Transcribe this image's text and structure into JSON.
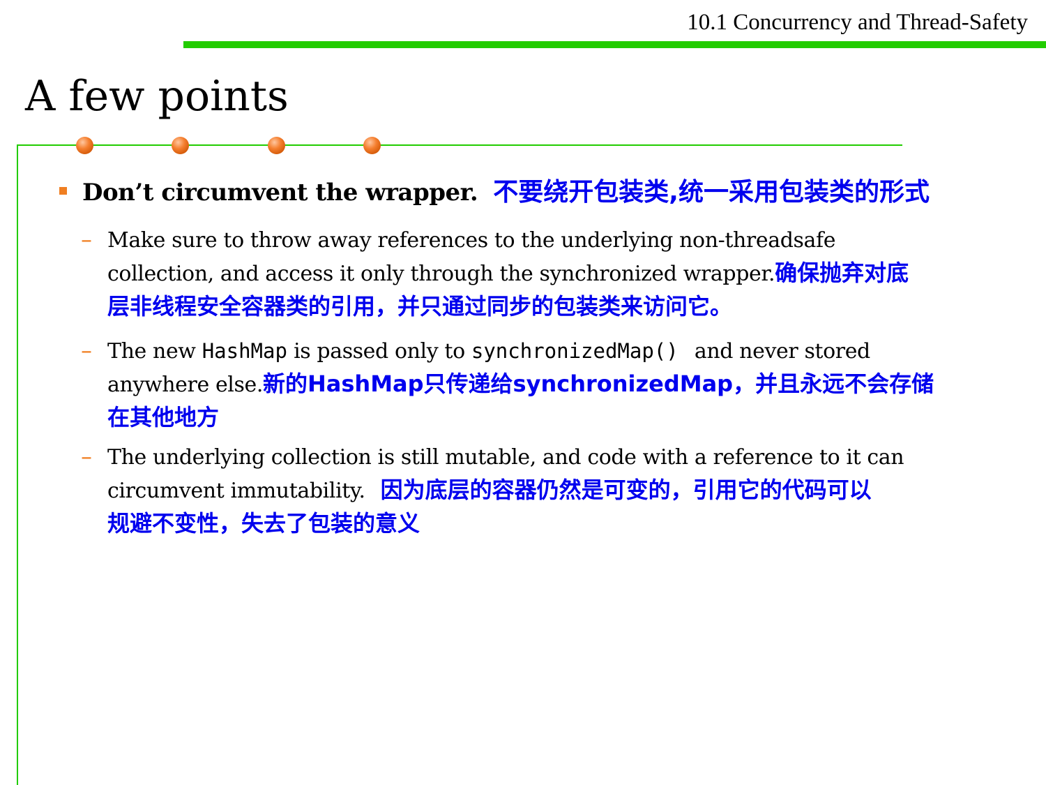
{
  "header": {
    "section_title": "10.1 Concurrency and Thread-Safety"
  },
  "slide": {
    "title": "A few points"
  },
  "colors": {
    "accent_green": "#22cc00",
    "dot_orange": "#f57f2f",
    "bullet_orange": "#f07f22",
    "chinese_blue": "#0000ee"
  },
  "bullets": [
    {
      "text": "Don’t circumvent the wrapper.",
      "translation": "不要绕开包装类,统一采用包装类的形式",
      "sub_items": [
        {
          "lines": [
            "Make sure to throw away references to the underlying non-threadsafe",
            "collection, and access it only through the synchronized wrapper."
          ],
          "translation_line1": "确保抛弃对底",
          "translation_line2": "层非线程安全容器类的引用，并只通过同步的包装类来访问它。"
        },
        {
          "part1": "The new ",
          "code1": "HashMap",
          "part2": " is passed only to ",
          "code2": "synchronizedMap()",
          "part3": " and never stored",
          "part4": "anywhere else.",
          "translation_line1": "新的HashMap只传递给synchronizedMap，并且永远不会存储",
          "translation_line2": "在其他地方"
        },
        {
          "lines": [
            "The underlying collection is still mutable, and code with a reference to it can",
            "circumvent immutability."
          ],
          "translation_line1": "因为底层的容器仍然是可变的，引用它的代码可以",
          "translation_line2": "规避不变性，失去了包装的意义"
        }
      ]
    }
  ]
}
